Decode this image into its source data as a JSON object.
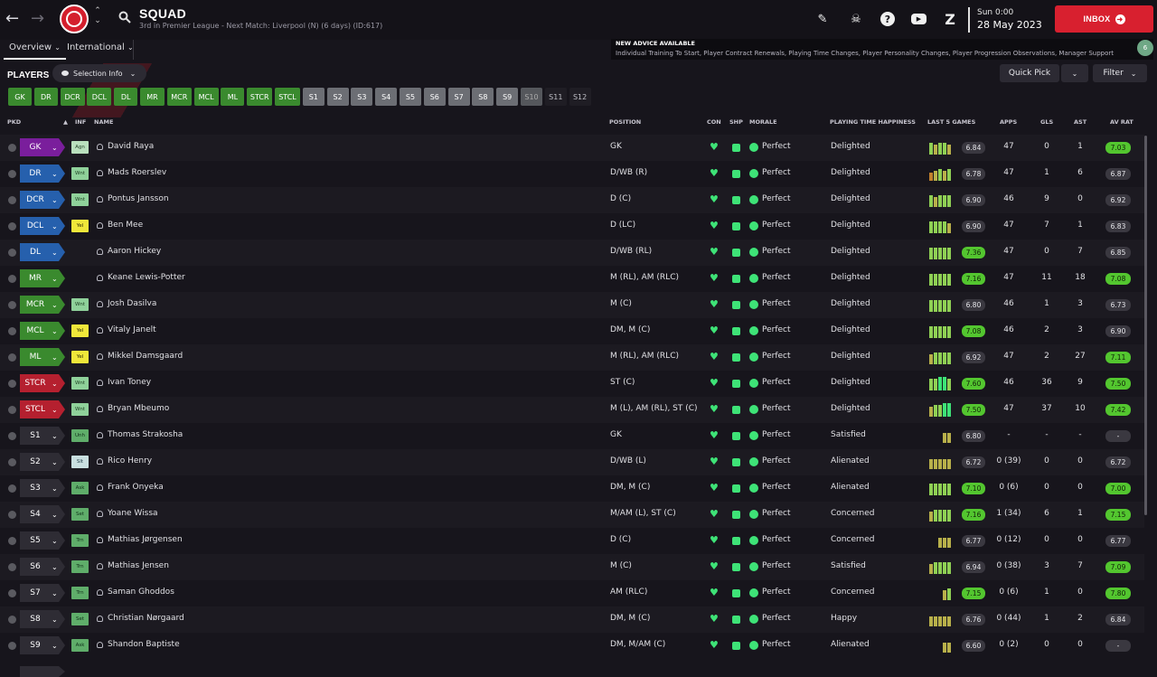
{
  "header": {
    "title": "SQUAD",
    "subtitle": "3rd in Premier League - Next Match: Liverpool (N) (6 days) (ID:617)",
    "time": "Sun 0:00",
    "date": "28 May 2023",
    "inbox_label": "INBOX",
    "help_glyph": "?",
    "z_glyph": "Z"
  },
  "tabs": [
    {
      "label": "Overview"
    },
    {
      "label": "International"
    }
  ],
  "advice": {
    "title": "NEW ADVICE AVAILABLE",
    "body": "Individual Training To Start, Player Contract Renewals, Playing Time Changes, Player Personality Changes, Player Progression Observations, Manager Support",
    "count": "6"
  },
  "toolbar": {
    "players_heading": "PLAYERS",
    "selection_info": "Selection Info",
    "quick_pick": "Quick Pick",
    "filter": "Filter"
  },
  "position_chips": [
    {
      "label": "GK",
      "state": "filled"
    },
    {
      "label": "DR",
      "state": "filled"
    },
    {
      "label": "DCR",
      "state": "filled"
    },
    {
      "label": "DCL",
      "state": "filled"
    },
    {
      "label": "DL",
      "state": "filled"
    },
    {
      "label": "MR",
      "state": "filled"
    },
    {
      "label": "MCR",
      "state": "filled"
    },
    {
      "label": "MCL",
      "state": "filled"
    },
    {
      "label": "ML",
      "state": "filled"
    },
    {
      "label": "STCR",
      "state": "filled"
    },
    {
      "label": "STCL",
      "state": "filled"
    },
    {
      "label": "S1",
      "state": "sub"
    },
    {
      "label": "S2",
      "state": "sub"
    },
    {
      "label": "S3",
      "state": "sub"
    },
    {
      "label": "S4",
      "state": "sub"
    },
    {
      "label": "S5",
      "state": "sub"
    },
    {
      "label": "S6",
      "state": "sub"
    },
    {
      "label": "S7",
      "state": "sub"
    },
    {
      "label": "S8",
      "state": "sub"
    },
    {
      "label": "S9",
      "state": "sub"
    },
    {
      "label": "S10",
      "state": "sub-dim"
    },
    {
      "label": "S11",
      "state": "empty"
    },
    {
      "label": "S12",
      "state": "empty"
    }
  ],
  "columns": {
    "pkd": "PKD",
    "inf": "INF",
    "name": "NAME",
    "position": "POSITION",
    "con": "CON",
    "shp": "SHP",
    "morale": "MORALE",
    "playing_time": "PLAYING TIME HAPPINESS",
    "last5": "LAST 5 GAMES",
    "apps": "APPS",
    "gls": "GLS",
    "ast": "AST",
    "avrat": "AV RAT"
  },
  "players": [
    {
      "pkd": "GK",
      "pkd_color": "purple",
      "inf": "Agn",
      "inf_color": "lg",
      "name": "David Raya",
      "position": "GK",
      "morale": "Perfect",
      "happiness": "Delighted",
      "bars": [
        3,
        2,
        3,
        3,
        2
      ],
      "last5": "6.84",
      "last5_good": false,
      "apps": "47",
      "gls": "0",
      "ast": "1",
      "avrat": "7.03",
      "avrat_good": true
    },
    {
      "pkd": "DR",
      "pkd_color": "blue",
      "inf": "Wnt",
      "inf_color": "g",
      "name": "Mads Roerslev",
      "position": "D/WB (R)",
      "morale": "Perfect",
      "happiness": "Delighted",
      "bars": [
        1,
        2,
        3,
        2,
        3
      ],
      "last5": "6.78",
      "last5_good": false,
      "apps": "47",
      "gls": "1",
      "ast": "6",
      "avrat": "6.87",
      "avrat_good": false
    },
    {
      "pkd": "DCR",
      "pkd_color": "blue",
      "inf": "Wnt",
      "inf_color": "g",
      "name": "Pontus Jansson",
      "position": "D (C)",
      "morale": "Perfect",
      "happiness": "Delighted",
      "bars": [
        3,
        2,
        3,
        3,
        3
      ],
      "last5": "6.90",
      "last5_good": false,
      "apps": "46",
      "gls": "9",
      "ast": "0",
      "avrat": "6.92",
      "avrat_good": false
    },
    {
      "pkd": "DCL",
      "pkd_color": "blue",
      "inf": "Yel",
      "inf_color": "y",
      "name": "Ben Mee",
      "position": "D (LC)",
      "morale": "Perfect",
      "happiness": "Delighted",
      "bars": [
        3,
        3,
        3,
        3,
        2
      ],
      "last5": "6.90",
      "last5_good": false,
      "apps": "47",
      "gls": "7",
      "ast": "1",
      "avrat": "6.83",
      "avrat_good": false
    },
    {
      "pkd": "DL",
      "pkd_color": "blue",
      "inf": "",
      "inf_color": "",
      "name": "Aaron Hickey",
      "position": "D/WB (RL)",
      "morale": "Perfect",
      "happiness": "Delighted",
      "bars": [
        3,
        3,
        3,
        3,
        3
      ],
      "last5": "7.36",
      "last5_good": true,
      "apps": "47",
      "gls": "0",
      "ast": "7",
      "avrat": "6.85",
      "avrat_good": false
    },
    {
      "pkd": "MR",
      "pkd_color": "green",
      "inf": "",
      "inf_color": "",
      "name": "Keane Lewis-Potter",
      "position": "M (RL), AM (RLC)",
      "morale": "Perfect",
      "happiness": "Delighted",
      "bars": [
        3,
        3,
        3,
        3,
        3
      ],
      "last5": "7.16",
      "last5_good": true,
      "apps": "47",
      "gls": "11",
      "ast": "18",
      "avrat": "7.08",
      "avrat_good": true
    },
    {
      "pkd": "MCR",
      "pkd_color": "green",
      "inf": "Wnt",
      "inf_color": "g",
      "name": "Josh Dasilva",
      "position": "M (C)",
      "morale": "Perfect",
      "happiness": "Delighted",
      "bars": [
        3,
        3,
        3,
        3,
        3
      ],
      "last5": "6.80",
      "last5_good": false,
      "apps": "46",
      "gls": "1",
      "ast": "3",
      "avrat": "6.73",
      "avrat_good": false
    },
    {
      "pkd": "MCL",
      "pkd_color": "green",
      "inf": "Yel",
      "inf_color": "y",
      "name": "Vitaly Janelt",
      "position": "DM, M (C)",
      "morale": "Perfect",
      "happiness": "Delighted",
      "bars": [
        3,
        3,
        3,
        3,
        3
      ],
      "last5": "7.08",
      "last5_good": true,
      "apps": "46",
      "gls": "2",
      "ast": "3",
      "avrat": "6.90",
      "avrat_good": false
    },
    {
      "pkd": "ML",
      "pkd_color": "green",
      "inf": "Yel",
      "inf_color": "y",
      "name": "Mikkel Damsgaard",
      "position": "M (RL), AM (RLC)",
      "morale": "Perfect",
      "happiness": "Delighted",
      "bars": [
        2,
        3,
        3,
        3,
        3
      ],
      "last5": "6.92",
      "last5_good": false,
      "apps": "47",
      "gls": "2",
      "ast": "27",
      "avrat": "7.11",
      "avrat_good": true
    },
    {
      "pkd": "STCR",
      "pkd_color": "red",
      "inf": "Wnt",
      "inf_color": "g",
      "name": "Ivan Toney",
      "position": "ST (C)",
      "morale": "Perfect",
      "happiness": "Delighted",
      "bars": [
        3,
        3,
        4,
        4,
        3
      ],
      "last5": "7.60",
      "last5_good": true,
      "apps": "46",
      "gls": "36",
      "ast": "9",
      "avrat": "7.50",
      "avrat_good": true
    },
    {
      "pkd": "STCL",
      "pkd_color": "red",
      "inf": "Wnt",
      "inf_color": "g",
      "name": "Bryan Mbeumo",
      "position": "M (L), AM (RL), ST (C)",
      "morale": "Perfect",
      "happiness": "Delighted",
      "bars": [
        2,
        3,
        3,
        4,
        4
      ],
      "last5": "7.50",
      "last5_good": true,
      "apps": "47",
      "gls": "37",
      "ast": "10",
      "avrat": "7.42",
      "avrat_good": true
    },
    {
      "pkd": "S1",
      "pkd_color": "sub",
      "inf": "Unh",
      "inf_color": "dg",
      "name": "Thomas Strakosha",
      "position": "GK",
      "morale": "Perfect",
      "happiness": "Satisfied",
      "bars": [
        0,
        0,
        0,
        2,
        2
      ],
      "last5": "6.80",
      "last5_good": false,
      "apps": "-",
      "gls": "-",
      "ast": "-",
      "avrat": "-",
      "avrat_good": false
    },
    {
      "pkd": "S2",
      "pkd_color": "sub",
      "inf": "Slt",
      "inf_color": "p",
      "name": "Rico Henry",
      "position": "D/WB (L)",
      "morale": "Perfect",
      "happiness": "Alienated",
      "bars": [
        2,
        2,
        2,
        2,
        2
      ],
      "last5": "6.72",
      "last5_good": false,
      "apps": "0 (39)",
      "gls": "0",
      "ast": "0",
      "avrat": "6.72",
      "avrat_good": false
    },
    {
      "pkd": "S3",
      "pkd_color": "sub",
      "inf": "Ask",
      "inf_color": "dg",
      "name": "Frank Onyeka",
      "position": "DM, M (C)",
      "morale": "Perfect",
      "happiness": "Alienated",
      "bars": [
        3,
        3,
        3,
        3,
        3
      ],
      "last5": "7.10",
      "last5_good": true,
      "apps": "0 (6)",
      "gls": "0",
      "ast": "0",
      "avrat": "7.00",
      "avrat_good": true
    },
    {
      "pkd": "S4",
      "pkd_color": "sub",
      "inf": "Set",
      "inf_color": "dg",
      "name": "Yoane Wissa",
      "position": "M/AM (L), ST (C)",
      "morale": "Perfect",
      "happiness": "Concerned",
      "bars": [
        2,
        3,
        3,
        3,
        3
      ],
      "last5": "7.16",
      "last5_good": true,
      "apps": "1 (34)",
      "gls": "6",
      "ast": "1",
      "avrat": "7.15",
      "avrat_good": true
    },
    {
      "pkd": "S5",
      "pkd_color": "sub",
      "inf": "Trn",
      "inf_color": "dg",
      "name": "Mathias Jørgensen",
      "position": "D (C)",
      "morale": "Perfect",
      "happiness": "Concerned",
      "bars": [
        0,
        0,
        2,
        2,
        2
      ],
      "last5": "6.77",
      "last5_good": false,
      "apps": "0 (12)",
      "gls": "0",
      "ast": "0",
      "avrat": "6.77",
      "avrat_good": false
    },
    {
      "pkd": "S6",
      "pkd_color": "sub",
      "inf": "Trn",
      "inf_color": "dg",
      "name": "Mathias Jensen",
      "position": "M (C)",
      "morale": "Perfect",
      "happiness": "Satisfied",
      "bars": [
        2,
        3,
        3,
        3,
        3
      ],
      "last5": "6.94",
      "last5_good": false,
      "apps": "0 (38)",
      "gls": "3",
      "ast": "7",
      "avrat": "7.09",
      "avrat_good": true
    },
    {
      "pkd": "S7",
      "pkd_color": "sub",
      "inf": "Trn",
      "inf_color": "dg",
      "name": "Saman Ghoddos",
      "position": "AM (RLC)",
      "morale": "Perfect",
      "happiness": "Concerned",
      "bars": [
        0,
        0,
        0,
        2,
        3
      ],
      "last5": "7.15",
      "last5_good": true,
      "apps": "0 (6)",
      "gls": "1",
      "ast": "0",
      "avrat": "7.80",
      "avrat_good": true
    },
    {
      "pkd": "S8",
      "pkd_color": "sub",
      "inf": "Set",
      "inf_color": "dg",
      "name": "Christian Nørgaard",
      "position": "DM, M (C)",
      "morale": "Perfect",
      "happiness": "Happy",
      "bars": [
        2,
        2,
        2,
        2,
        2
      ],
      "last5": "6.76",
      "last5_good": false,
      "apps": "0 (44)",
      "gls": "1",
      "ast": "2",
      "avrat": "6.84",
      "avrat_good": false
    },
    {
      "pkd": "S9",
      "pkd_color": "sub",
      "inf": "Ask",
      "inf_color": "dg",
      "name": "Shandon Baptiste",
      "position": "DM, M/AM (C)",
      "morale": "Perfect",
      "happiness": "Alienated",
      "bars": [
        0,
        0,
        0,
        2,
        2
      ],
      "last5": "6.60",
      "last5_good": false,
      "apps": "0 (2)",
      "gls": "0",
      "ast": "0",
      "avrat": "-",
      "avrat_good": false
    }
  ],
  "colors": {
    "accent_red": "#d8202f",
    "positive_green": "#3ee377",
    "rating_green": "#53c62f"
  }
}
